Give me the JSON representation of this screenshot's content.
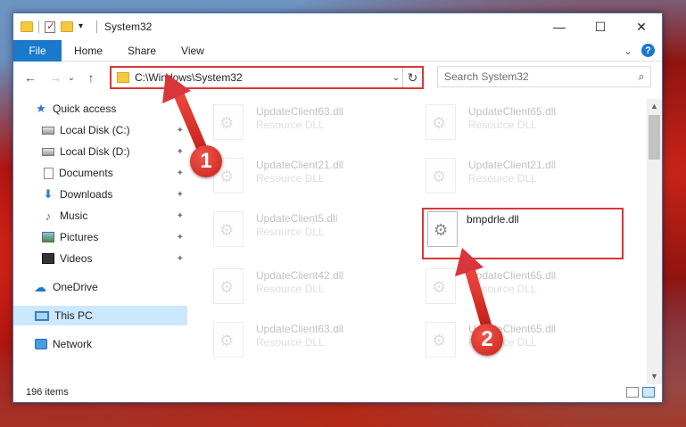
{
  "window": {
    "title": "System32",
    "minimize_glyph": "—",
    "maximize_glyph": "☐",
    "close_glyph": "✕"
  },
  "ribbon": {
    "tabs": [
      "File",
      "Home",
      "Share",
      "View"
    ],
    "expand_glyph": "⌄",
    "help_glyph": "?"
  },
  "nav": {
    "back_glyph": "←",
    "forward_glyph": "→",
    "recent_glyph": "⌄",
    "up_glyph": "↑"
  },
  "address": {
    "path": "C:\\Windows\\System32",
    "dropdown_glyph": "⌄",
    "refresh_glyph": "↻"
  },
  "search": {
    "placeholder": "Search System32",
    "icon_glyph": "⌕"
  },
  "sidebar": {
    "quick_access": "Quick access",
    "items": [
      {
        "label": "Local Disk (C:)",
        "icon": "drive-icon"
      },
      {
        "label": "Local Disk (D:)",
        "icon": "drive-icon"
      },
      {
        "label": "Documents",
        "icon": "documents-icon"
      },
      {
        "label": "Downloads",
        "icon": "downloads-icon"
      },
      {
        "label": "Music",
        "icon": "music-icon"
      },
      {
        "label": "Pictures",
        "icon": "pictures-icon"
      },
      {
        "label": "Videos",
        "icon": "videos-icon"
      }
    ],
    "onedrive": "OneDrive",
    "this_pc": "This PC",
    "network": "Network",
    "pin_glyph": "📌"
  },
  "files": [
    {
      "name": "UpdateClient63.dll",
      "type": "Resource DLL",
      "faded": true
    },
    {
      "name": "UpdateClient65.dll",
      "type": "Resource DLL",
      "faded": true
    },
    {
      "name": "UpdateClient21.dll",
      "type": "Resource DLL",
      "faded": true
    },
    {
      "name": "UpdateClient21.dll",
      "type": "Resource DLL",
      "faded": true
    },
    {
      "name": "UpdateClient5.dll",
      "type": "Resource DLL",
      "faded": true
    },
    {
      "name": "bmpdrle.dll",
      "type": "",
      "faded": false
    },
    {
      "name": "UpdateClient42.dll",
      "type": "Resource DLL",
      "faded": true
    },
    {
      "name": "UpdateClient65.dll",
      "type": "Resource DLL",
      "faded": true
    },
    {
      "name": "UpdateClient63.dll",
      "type": "Resource DLL",
      "faded": true
    },
    {
      "name": "UpdateClient65.dll",
      "type": "Resource DLL",
      "faded": true
    }
  ],
  "status": {
    "item_count": "196 items"
  },
  "annotations": {
    "marker1": "1",
    "marker2": "2",
    "color": "#d8363a"
  }
}
